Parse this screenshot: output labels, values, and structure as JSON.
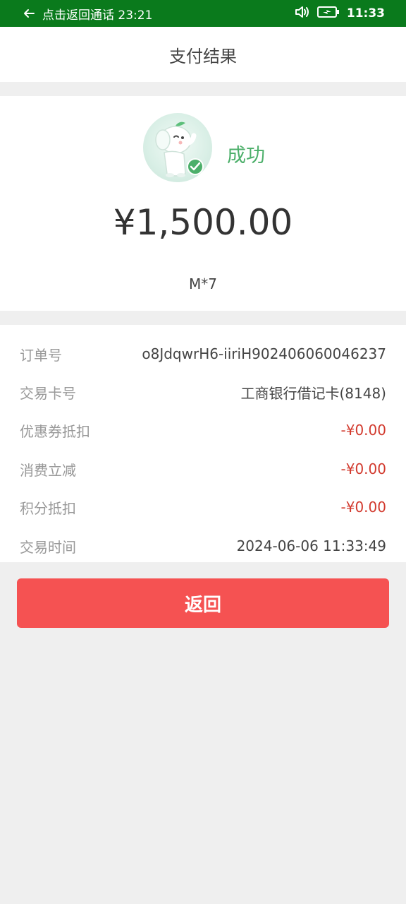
{
  "status_bar": {
    "call_text": "点击返回通话 23:21",
    "time": "11:33",
    "icons": {
      "back": "arrow-left-icon",
      "volume": "speaker-icon",
      "battery": "battery-charging-icon"
    }
  },
  "header": {
    "title": "支付结果"
  },
  "result": {
    "status_text": "成功",
    "amount": "¥1,500.00",
    "merchant": "M*7",
    "success_color": "#4caf6a"
  },
  "details": {
    "rows": [
      {
        "label": "订单号",
        "value": "o8JdqwrH6-iiriH902406060046237"
      },
      {
        "label": "交易卡号",
        "value": "工商银行借记卡(8148)"
      },
      {
        "label": "优惠券抵扣",
        "value": "-¥0.00"
      },
      {
        "label": "消费立减",
        "value": "-¥0.00"
      },
      {
        "label": "积分抵扣",
        "value": "-¥0.00"
      },
      {
        "label": "交易时间",
        "value": "2024-06-06 11:33:49"
      }
    ],
    "discount_color": "#d23a2e"
  },
  "actions": {
    "return_label": "返回",
    "button_color": "#f55252"
  },
  "colors": {
    "status_bar": "#0a7a1c",
    "page_background": "#efefef"
  }
}
